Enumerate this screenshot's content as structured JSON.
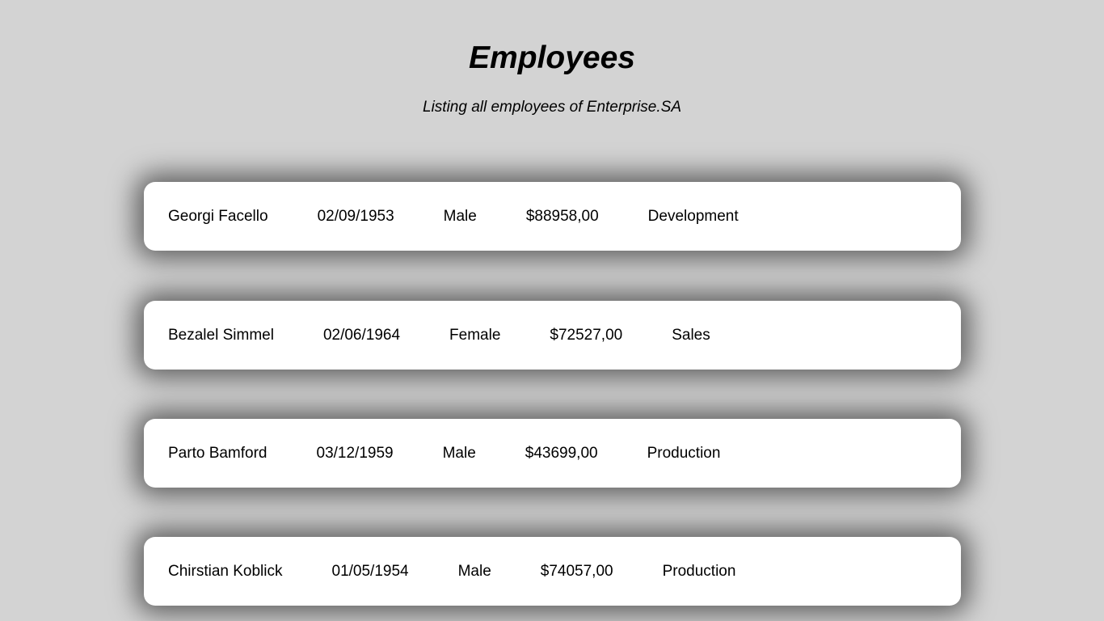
{
  "header": {
    "title": "Employees",
    "subtitle": "Listing all employees of Enterprise.SA"
  },
  "employees": [
    {
      "name": "Georgi Facello",
      "birth_date": "02/09/1953",
      "gender": "Male",
      "salary": "$88958,00",
      "department": "Development"
    },
    {
      "name": "Bezalel Simmel",
      "birth_date": "02/06/1964",
      "gender": "Female",
      "salary": "$72527,00",
      "department": "Sales"
    },
    {
      "name": "Parto Bamford",
      "birth_date": "03/12/1959",
      "gender": "Male",
      "salary": "$43699,00",
      "department": "Production"
    },
    {
      "name": "Chirstian Koblick",
      "birth_date": "01/05/1954",
      "gender": "Male",
      "salary": "$74057,00",
      "department": "Production"
    }
  ],
  "colors": {
    "background": "#d3d3d3",
    "card": "#ffffff",
    "text": "#000000"
  }
}
